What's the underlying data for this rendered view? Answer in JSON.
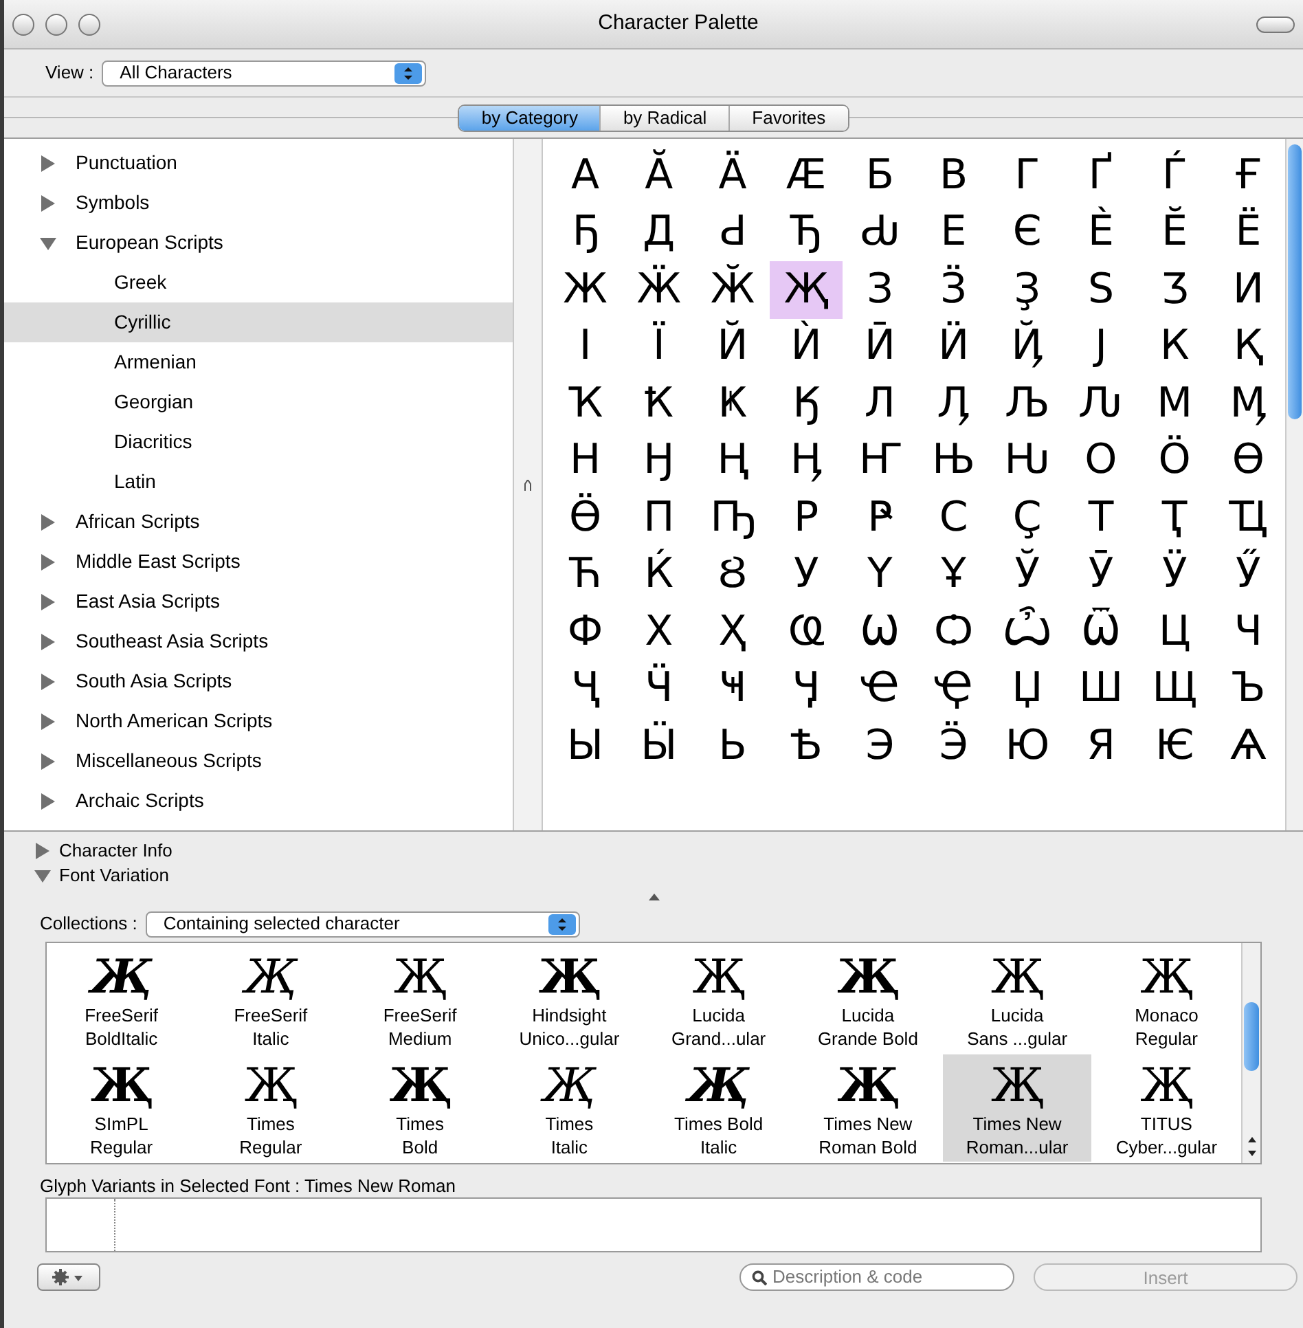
{
  "window": {
    "title": "Character Palette"
  },
  "view": {
    "label": "View :",
    "value": "All Characters"
  },
  "tabs": [
    {
      "label": "by Category",
      "selected": true
    },
    {
      "label": "by Radical",
      "selected": false
    },
    {
      "label": "Favorites",
      "selected": false
    }
  ],
  "sidebar": {
    "items": [
      {
        "label": "Punctuation",
        "expanded": false,
        "selected": false
      },
      {
        "label": "Symbols",
        "expanded": false,
        "selected": false
      },
      {
        "label": "European Scripts",
        "expanded": true,
        "selected": false,
        "children": [
          {
            "label": "Greek",
            "selected": false
          },
          {
            "label": "Cyrillic",
            "selected": true
          },
          {
            "label": "Armenian",
            "selected": false
          },
          {
            "label": "Georgian",
            "selected": false
          },
          {
            "label": "Diacritics",
            "selected": false
          },
          {
            "label": "Latin",
            "selected": false
          }
        ]
      },
      {
        "label": "African Scripts",
        "expanded": false,
        "selected": false
      },
      {
        "label": "Middle East Scripts",
        "expanded": false,
        "selected": false
      },
      {
        "label": "East Asia Scripts",
        "expanded": false,
        "selected": false
      },
      {
        "label": "Southeast Asia Scripts",
        "expanded": false,
        "selected": false
      },
      {
        "label": "South Asia Scripts",
        "expanded": false,
        "selected": false
      },
      {
        "label": "North American Scripts",
        "expanded": false,
        "selected": false
      },
      {
        "label": "Miscellaneous Scripts",
        "expanded": false,
        "selected": false
      },
      {
        "label": "Archaic Scripts",
        "expanded": false,
        "selected": false
      }
    ]
  },
  "characters": [
    {
      "char": "А",
      "selected": false
    },
    {
      "char": "Ӑ",
      "selected": false
    },
    {
      "char": "Ӓ",
      "selected": false
    },
    {
      "char": "Ӕ",
      "selected": false
    },
    {
      "char": "Б",
      "selected": false
    },
    {
      "char": "В",
      "selected": false
    },
    {
      "char": "Г",
      "selected": false
    },
    {
      "char": "Ґ",
      "selected": false
    },
    {
      "char": "Ѓ",
      "selected": false
    },
    {
      "char": "Ғ",
      "selected": false
    },
    {
      "char": "Ҕ",
      "selected": false
    },
    {
      "char": "Д",
      "selected": false
    },
    {
      "char": "Ԁ",
      "selected": false
    },
    {
      "char": "Ђ",
      "selected": false
    },
    {
      "char": "Ԃ",
      "selected": false
    },
    {
      "char": "Е",
      "selected": false
    },
    {
      "char": "Є",
      "selected": false
    },
    {
      "char": "Ѐ",
      "selected": false
    },
    {
      "char": "Ӗ",
      "selected": false
    },
    {
      "char": "Ё",
      "selected": false
    },
    {
      "char": "Ж",
      "selected": false
    },
    {
      "char": "Ӝ",
      "selected": false
    },
    {
      "char": "Ӂ",
      "selected": false
    },
    {
      "char": "Җ",
      "selected": true
    },
    {
      "char": "З",
      "selected": false
    },
    {
      "char": "Ӟ",
      "selected": false
    },
    {
      "char": "Ҙ",
      "selected": false
    },
    {
      "char": "Ѕ",
      "selected": false
    },
    {
      "char": "Ӡ",
      "selected": false
    },
    {
      "char": "И",
      "selected": false
    },
    {
      "char": "І",
      "selected": false
    },
    {
      "char": "Ї",
      "selected": false
    },
    {
      "char": "Й",
      "selected": false
    },
    {
      "char": "Ѝ",
      "selected": false
    },
    {
      "char": "Ӣ",
      "selected": false
    },
    {
      "char": "Ӥ",
      "selected": false
    },
    {
      "char": "Ҋ",
      "selected": false
    },
    {
      "char": "Ј",
      "selected": false
    },
    {
      "char": "К",
      "selected": false
    },
    {
      "char": "Қ",
      "selected": false
    },
    {
      "char": "Ҡ",
      "selected": false
    },
    {
      "char": "Ҟ",
      "selected": false
    },
    {
      "char": "Ҝ",
      "selected": false
    },
    {
      "char": "Ӄ",
      "selected": false
    },
    {
      "char": "Л",
      "selected": false
    },
    {
      "char": "Ӆ",
      "selected": false
    },
    {
      "char": "Љ",
      "selected": false
    },
    {
      "char": "Ԉ",
      "selected": false
    },
    {
      "char": "М",
      "selected": false
    },
    {
      "char": "Ӎ",
      "selected": false
    },
    {
      "char": "Н",
      "selected": false
    },
    {
      "char": "Ӈ",
      "selected": false
    },
    {
      "char": "Ң",
      "selected": false
    },
    {
      "char": "Ӊ",
      "selected": false
    },
    {
      "char": "Ҥ",
      "selected": false
    },
    {
      "char": "Њ",
      "selected": false
    },
    {
      "char": "Ԋ",
      "selected": false
    },
    {
      "char": "О",
      "selected": false
    },
    {
      "char": "Ӧ",
      "selected": false
    },
    {
      "char": "Ө",
      "selected": false
    },
    {
      "char": "Ӫ",
      "selected": false
    },
    {
      "char": "П",
      "selected": false
    },
    {
      "char": "Ҧ",
      "selected": false
    },
    {
      "char": "Р",
      "selected": false
    },
    {
      "char": "Ҏ",
      "selected": false
    },
    {
      "char": "С",
      "selected": false
    },
    {
      "char": "Ҫ",
      "selected": false
    },
    {
      "char": "Т",
      "selected": false
    },
    {
      "char": "Ҭ",
      "selected": false
    },
    {
      "char": "Ҵ",
      "selected": false
    },
    {
      "char": "Ћ",
      "selected": false
    },
    {
      "char": "Ќ",
      "selected": false
    },
    {
      "char": "Ȣ",
      "selected": false
    },
    {
      "char": "У",
      "selected": false
    },
    {
      "char": "Ү",
      "selected": false
    },
    {
      "char": "Ұ",
      "selected": false
    },
    {
      "char": "Ў",
      "selected": false
    },
    {
      "char": "Ӯ",
      "selected": false
    },
    {
      "char": "Ӱ",
      "selected": false
    },
    {
      "char": "Ӳ",
      "selected": false
    },
    {
      "char": "Ф",
      "selected": false
    },
    {
      "char": "Х",
      "selected": false
    },
    {
      "char": "Ҳ",
      "selected": false
    },
    {
      "char": "Ҩ",
      "selected": false
    },
    {
      "char": "Ѡ",
      "selected": false
    },
    {
      "char": "Ѻ",
      "selected": false
    },
    {
      "char": "Ѽ",
      "selected": false
    },
    {
      "char": "Ѿ",
      "selected": false
    },
    {
      "char": "Ц",
      "selected": false
    },
    {
      "char": "Ч",
      "selected": false
    },
    {
      "char": "Ҷ",
      "selected": false
    },
    {
      "char": "Ӵ",
      "selected": false
    },
    {
      "char": "Ҹ",
      "selected": false
    },
    {
      "char": "Ӌ",
      "selected": false
    },
    {
      "char": "Ҽ",
      "selected": false
    },
    {
      "char": "Ҿ",
      "selected": false
    },
    {
      "char": "Џ",
      "selected": false
    },
    {
      "char": "Ш",
      "selected": false
    },
    {
      "char": "Щ",
      "selected": false
    },
    {
      "char": "Ъ",
      "selected": false
    },
    {
      "char": "Ы",
      "selected": false
    },
    {
      "char": "Ӹ",
      "selected": false
    },
    {
      "char": "Ь",
      "selected": false
    },
    {
      "char": "Ѣ",
      "selected": false
    },
    {
      "char": "Э",
      "selected": false
    },
    {
      "char": "Ӭ",
      "selected": false
    },
    {
      "char": "Ю",
      "selected": false
    },
    {
      "char": "Я",
      "selected": false
    },
    {
      "char": "Ѥ",
      "selected": false
    },
    {
      "char": "Ѧ",
      "selected": false
    }
  ],
  "sections": [
    {
      "label": "Character Info",
      "expanded": false
    },
    {
      "label": "Font Variation",
      "expanded": true
    }
  ],
  "collections": {
    "label": "Collections :",
    "value": "Containing selected character"
  },
  "fonts": [
    {
      "glyph": "Җ",
      "name": "FreeSerif",
      "style": "BoldItalic",
      "bold": true,
      "italic": true,
      "selected": false
    },
    {
      "glyph": "Җ",
      "name": "FreeSerif",
      "style": "Italic",
      "bold": false,
      "italic": true,
      "selected": false
    },
    {
      "glyph": "Җ",
      "name": "FreeSerif",
      "style": "Medium",
      "bold": false,
      "italic": false,
      "selected": false
    },
    {
      "glyph": "Җ",
      "name": "Hindsight",
      "style": "Unico...gular",
      "bold": true,
      "italic": false,
      "selected": false
    },
    {
      "glyph": "Җ",
      "name": "Lucida",
      "style": "Grand...ular",
      "bold": false,
      "italic": false,
      "selected": false
    },
    {
      "glyph": "Җ",
      "name": "Lucida",
      "style": "Grande Bold",
      "bold": true,
      "italic": false,
      "selected": false
    },
    {
      "glyph": "Җ",
      "name": "Lucida",
      "style": "Sans ...gular",
      "bold": false,
      "italic": false,
      "selected": false
    },
    {
      "glyph": "Җ",
      "name": "Monaco",
      "style": "Regular",
      "bold": false,
      "italic": false,
      "selected": false
    },
    {
      "glyph": "Җ",
      "name": "SImPL",
      "style": "Regular",
      "bold": true,
      "italic": false,
      "selected": false
    },
    {
      "glyph": "Җ",
      "name": "Times",
      "style": "Regular",
      "bold": false,
      "italic": false,
      "selected": false
    },
    {
      "glyph": "Җ",
      "name": "Times",
      "style": "Bold",
      "bold": true,
      "italic": false,
      "selected": false
    },
    {
      "glyph": "Җ",
      "name": "Times",
      "style": "Italic",
      "bold": false,
      "italic": true,
      "selected": false
    },
    {
      "glyph": "Җ",
      "name": "Times Bold",
      "style": "Italic",
      "bold": true,
      "italic": true,
      "selected": false
    },
    {
      "glyph": "Җ",
      "name": "Times New",
      "style": "Roman Bold",
      "bold": true,
      "italic": false,
      "selected": false
    },
    {
      "glyph": "Җ",
      "name": "Times New",
      "style": "Roman...ular",
      "bold": false,
      "italic": false,
      "selected": true
    },
    {
      "glyph": "Җ",
      "name": "TITUS",
      "style": "Cyber...gular",
      "bold": false,
      "italic": false,
      "selected": false
    }
  ],
  "glyph_variants": {
    "label": "Glyph Variants in Selected Font : Times New Roman"
  },
  "search": {
    "placeholder": "Description & code"
  },
  "insert_button": {
    "label": "Insert",
    "disabled": true
  }
}
